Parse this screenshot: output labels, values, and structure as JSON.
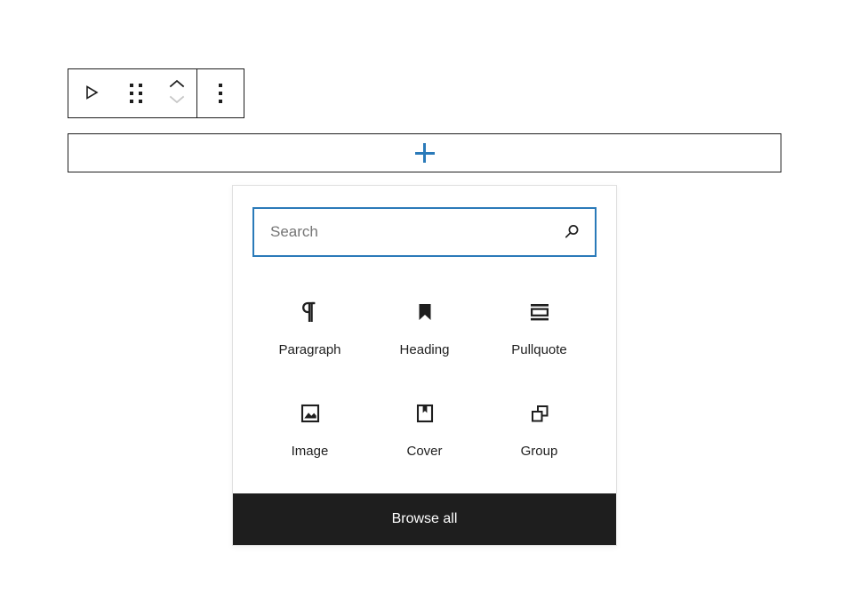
{
  "toolbar": {
    "transform_label": "Change block type",
    "drag_label": "Drag",
    "move_up_label": "Move up",
    "move_down_label": "Move down",
    "options_label": "Options",
    "icons": {
      "transform": "paragraph-transform-icon",
      "drag": "drag-handle-icon",
      "move_up": "chevron-up-icon",
      "move_down": "chevron-down-icon",
      "options": "more-vertical-icon"
    },
    "border_color": "#1e1e1e"
  },
  "inserter_bar": {
    "icon": "plus-icon",
    "label": "",
    "accent_color": "#2a7ab9",
    "border_color": "#1e1e1e"
  },
  "inserter_panel": {
    "search": {
      "placeholder": "Search",
      "value": "",
      "icon": "search-icon",
      "focus_color": "#2a7ab9"
    },
    "blocks": [
      {
        "label": "Paragraph",
        "icon": "pilcrow-icon"
      },
      {
        "label": "Heading",
        "icon": "bookmark-icon"
      },
      {
        "label": "Pullquote",
        "icon": "pullquote-icon"
      },
      {
        "label": "Image",
        "icon": "image-icon"
      },
      {
        "label": "Cover",
        "icon": "cover-icon"
      },
      {
        "label": "Group",
        "icon": "group-icon"
      }
    ],
    "browse_all_label": "Browse all",
    "browse_all_bg": "#1e1e1e",
    "border_color": "#e0e0e0"
  }
}
